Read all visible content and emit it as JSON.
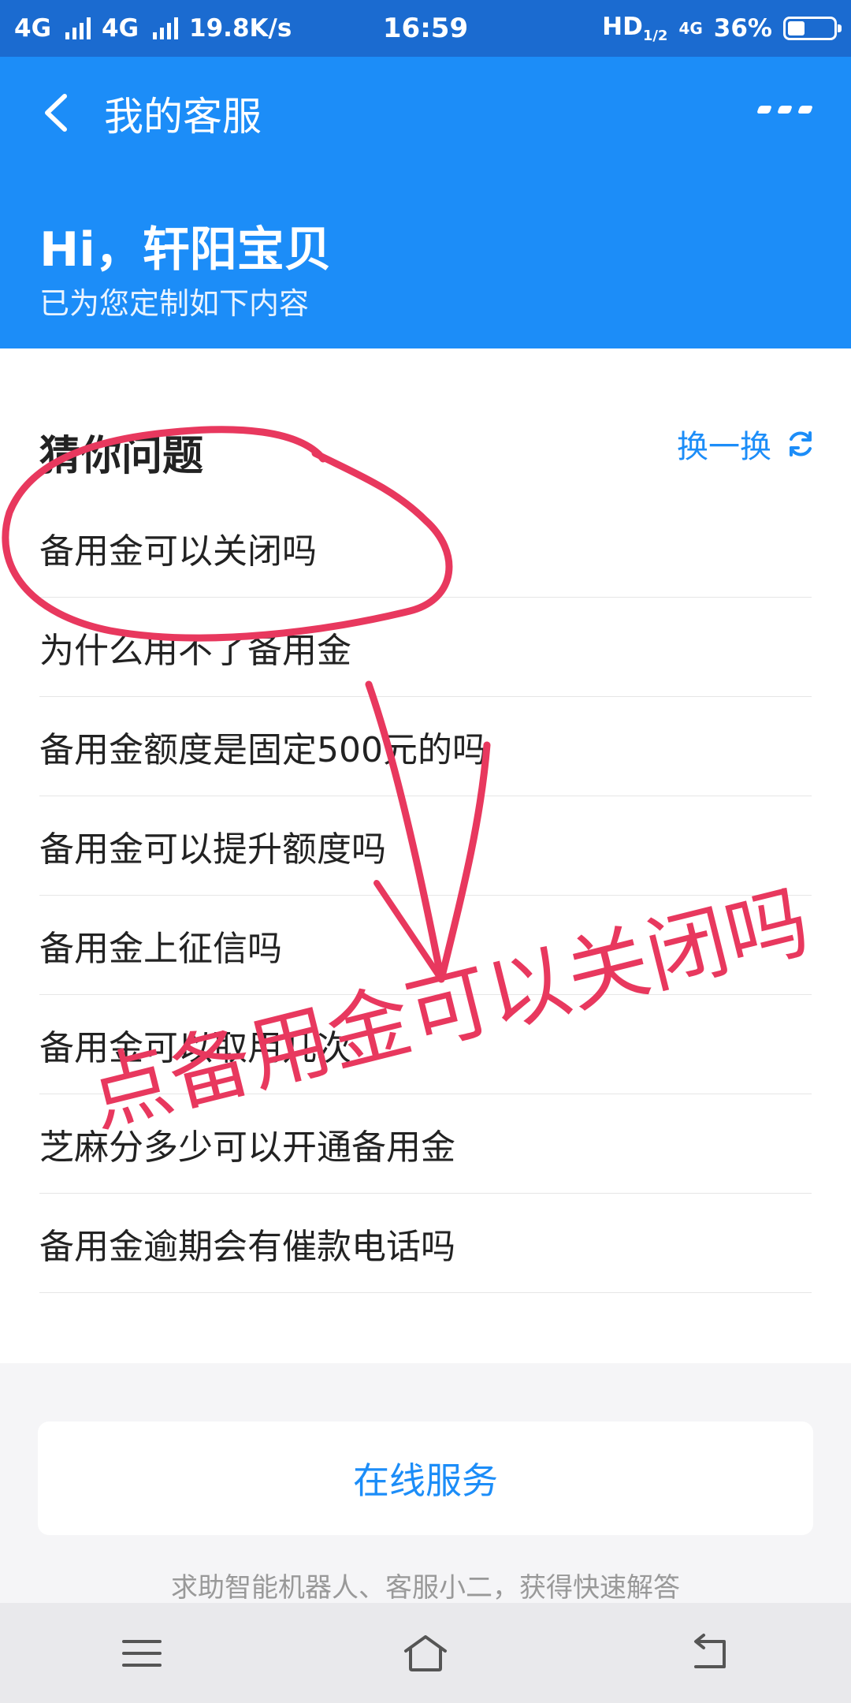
{
  "status_bar": {
    "network1": "4G",
    "network2": "4G",
    "speed": "19.8K/s",
    "time": "16:59",
    "hd": "HD",
    "hd_sub": "1/2",
    "net_small": "4G",
    "battery": "36%"
  },
  "header": {
    "title": "我的客服",
    "greeting": "Hi，轩阳宝贝",
    "subtitle": "已为您定制如下内容"
  },
  "questions": {
    "title": "猜你问题",
    "refresh_label": "换一换",
    "items": [
      "备用金可以关闭吗",
      "为什么用不了备用金",
      "备用金额度是固定500元的吗",
      "备用金可以提升额度吗",
      "备用金上征信吗",
      "备用金可以取用几次",
      "芝麻分多少可以开通备用金",
      "备用金逾期会有催款电话吗"
    ]
  },
  "service": {
    "button_label": "在线服务",
    "description": "求助智能机器人、客服小二，获得快速解答"
  },
  "annotation": {
    "text": "点备用金可以关闭吗",
    "color": "#e8385e"
  },
  "colors": {
    "status_bar": "#1b6bd0",
    "header": "#1c8df8",
    "accent": "#1c8df8"
  }
}
